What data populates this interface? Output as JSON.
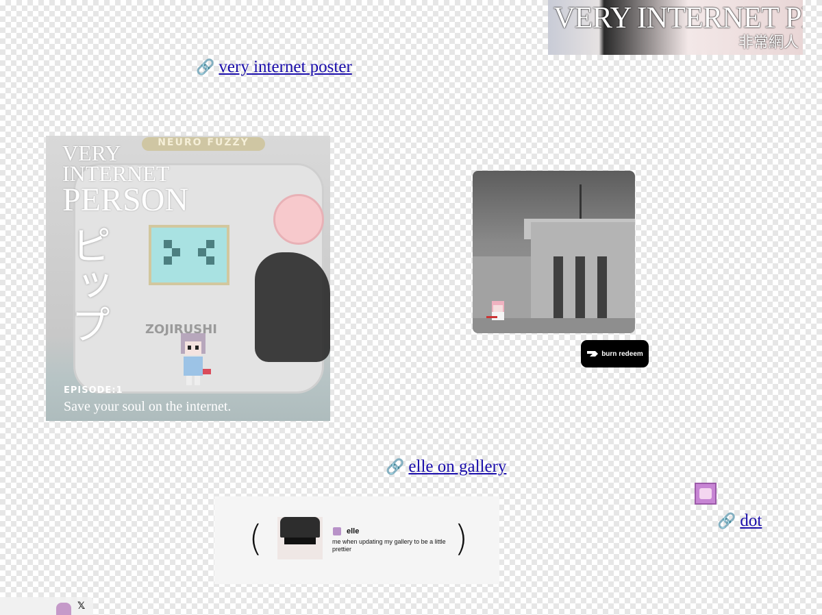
{
  "banner": {
    "title": "VERY INTERNET PERSON",
    "subtitle": "非常網人"
  },
  "links": {
    "poster": "very internet poster",
    "gallery": "elle on gallery",
    "dot": "dot"
  },
  "poster_art": {
    "brand": "NEURO FUZZY",
    "title_line1": "VERY",
    "title_line2": "INTERNET",
    "title_line3": "PERSON",
    "vertical_text": "ピップ",
    "maker": "ZOJIRUSHI",
    "episode": "EPISODE:1",
    "tagline": "Save your soul on the internet."
  },
  "burn_button": {
    "label": "burn redeem"
  },
  "embed": {
    "name": "elle",
    "text": "me when updating my gallery to be a little prettier",
    "open_paren": "(",
    "close_paren": ")"
  },
  "footer": {
    "x_label": "𝕏"
  },
  "icons": {
    "link": "chain-link-icon",
    "pink_avatar": "pink-avatar-icon"
  }
}
